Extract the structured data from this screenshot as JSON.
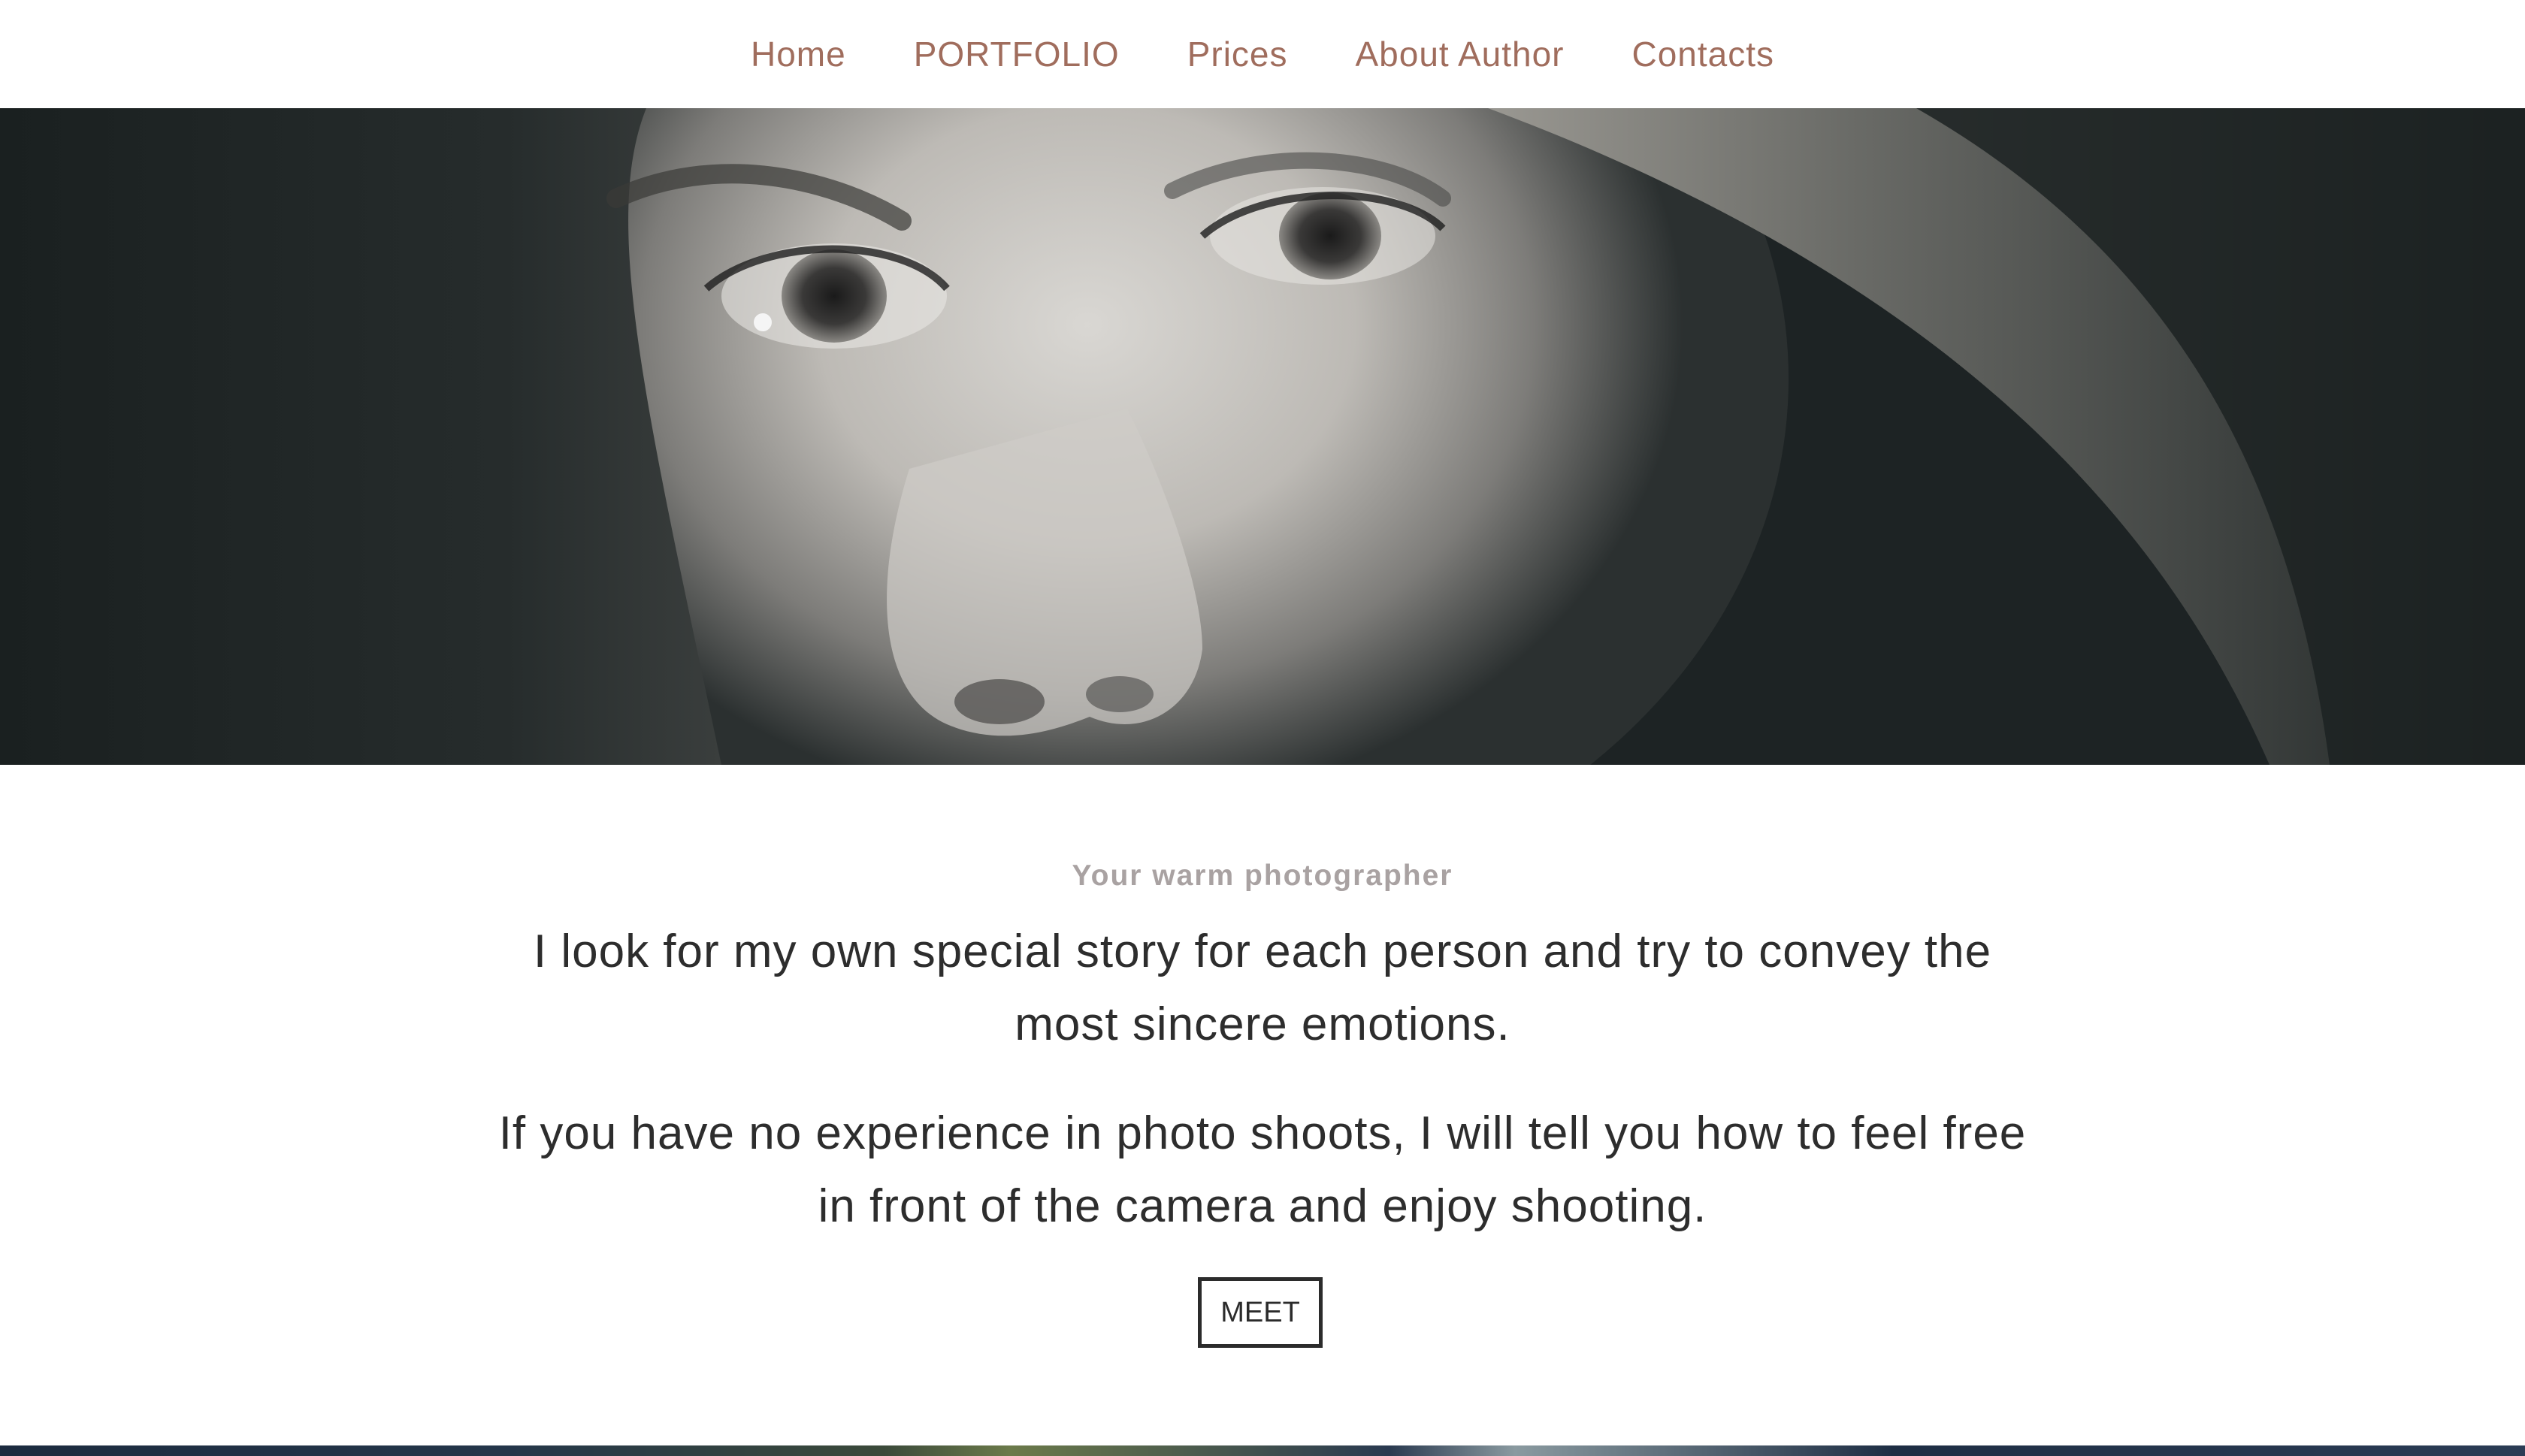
{
  "nav": {
    "items": [
      {
        "label": "Home"
      },
      {
        "label": "PORTFOLIO"
      },
      {
        "label": "Prices"
      },
      {
        "label": "About Author"
      },
      {
        "label": "Contacts"
      }
    ]
  },
  "hero": {
    "image": "black-and-white close-up portrait of a woman's eyes and nose"
  },
  "content": {
    "tagline": "Your warm photographer",
    "paragraph1": "I look for my own special story for each person and try to convey the most sincere emotions.",
    "paragraph2": "If you have no experience in photo shoots, I will tell you how to feel free in front of the camera and enjoy shooting.",
    "button_label": "MEET"
  },
  "colors": {
    "nav_text": "#a06d5d",
    "tagline": "#a9a2a2",
    "body_text": "#2d2d2d",
    "button_border": "#2b2b2b"
  }
}
